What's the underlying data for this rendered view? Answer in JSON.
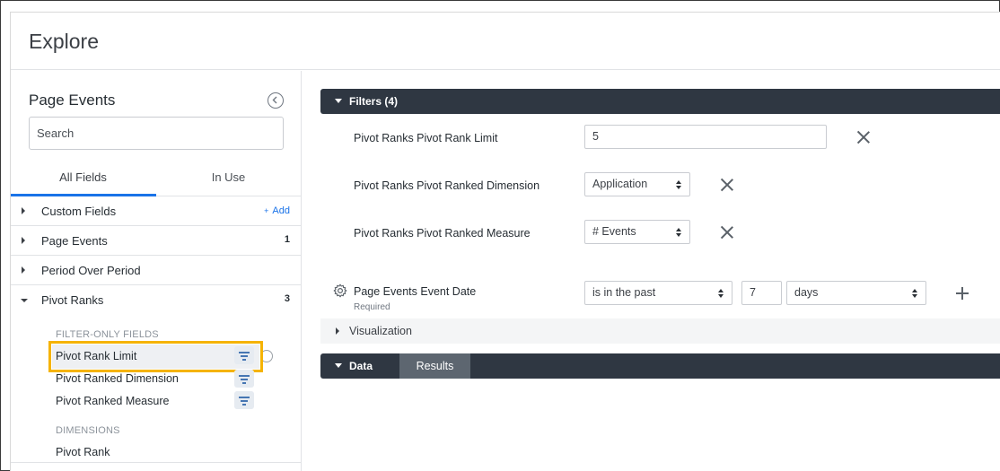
{
  "header": {
    "title": "Explore"
  },
  "sidebar": {
    "title": "Page Events",
    "search_placeholder": "Search",
    "tabs": [
      {
        "label": "All Fields"
      },
      {
        "label": "In Use"
      }
    ],
    "groups": [
      {
        "label": "Custom Fields",
        "action": "Add"
      },
      {
        "label": "Page Events",
        "count": "1"
      },
      {
        "label": "Period Over Period"
      },
      {
        "label": "Pivot Ranks",
        "count": "3"
      }
    ],
    "filter_only_heading": "FILTER-ONLY FIELDS",
    "filter_only_fields": [
      {
        "label": "Pivot Rank Limit"
      },
      {
        "label": "Pivot Ranked Dimension"
      },
      {
        "label": "Pivot Ranked Measure"
      }
    ],
    "dimensions_heading": "DIMENSIONS",
    "dimensions": [
      {
        "label": "Pivot Rank"
      }
    ]
  },
  "filters": {
    "header": "Filters (4)",
    "rows": [
      {
        "label": "Pivot Ranks Pivot Rank Limit",
        "value": "5"
      },
      {
        "label": "Pivot Ranks Pivot Ranked Dimension",
        "value": "Application"
      },
      {
        "label": "Pivot Ranks Pivot Ranked Measure",
        "value": "# Events"
      },
      {
        "label": "Page Events Event Date",
        "sub": "Required",
        "operator": "is in the past",
        "number": "7",
        "unit": "days"
      }
    ]
  },
  "visualization": {
    "label": "Visualization"
  },
  "data_bar": {
    "label": "Data",
    "results_tab": "Results"
  },
  "colors": {
    "accent": "#1a73e8",
    "highlight": "#f5b301",
    "bar": "#2f3742"
  }
}
